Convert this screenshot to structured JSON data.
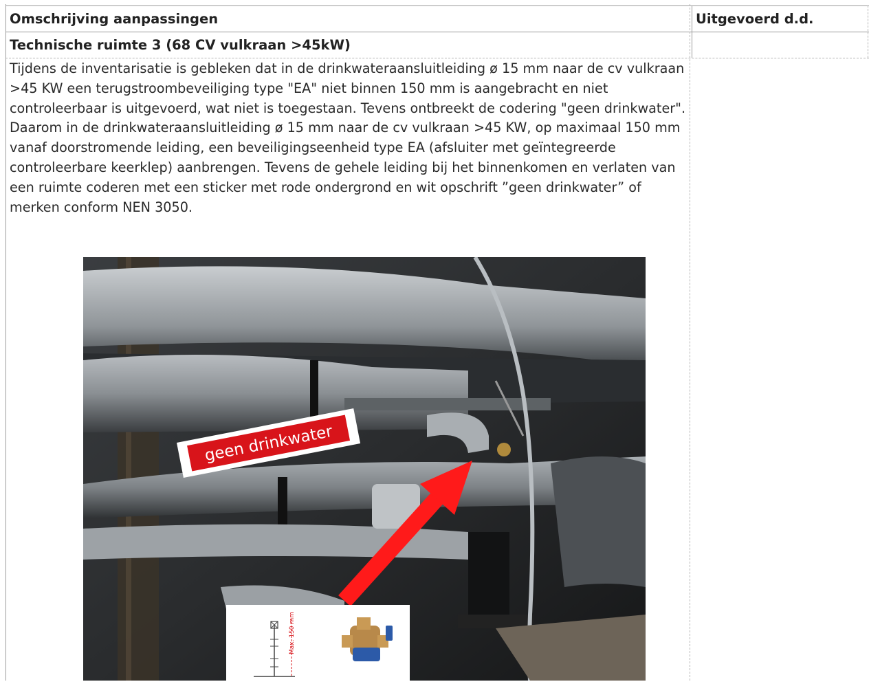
{
  "table": {
    "col1_header": "Omschrijving aanpassingen",
    "col2_header": "Uitgevoerd d.d.",
    "section_title": "Technische ruimte 3 (68 CV vulkraan >45kW)",
    "paragraph_1": "Tijdens de inventarisatie is gebleken dat in de  drinkwateraansluitleiding ø 15 mm naar de cv vulkraan >45 KW een terugstroombeveiliging type \"EA\" niet binnen 150 mm is aangebracht en niet controleerbaar is uitgevoerd, wat niet is toegestaan. Tevens ontbreekt de codering \"geen drinkwater\".",
    "paragraph_2": "Daarom in de drinkwateraansluitleiding ø 15 mm naar de cv vulkraan >45 KW, op maximaal 150 mm vanaf doorstromende leiding, een beveiligingseenheid type EA (afsluiter met geïntegreerde controleerbare keerklep) aanbrengen. Tevens de gehele leiding bij het binnenkomen en verlaten van een ruimte coderen met een sticker met rode ondergrond en wit opschrift ”geen drinkwater” of merken conform NEN 3050.",
    "done_date": ""
  },
  "photo": {
    "sticker_text": "geen drinkwater",
    "diagram_label": "Max. 150 mm",
    "sticker_color": "#d8141a",
    "arrow_color": "#ff1a1a"
  }
}
